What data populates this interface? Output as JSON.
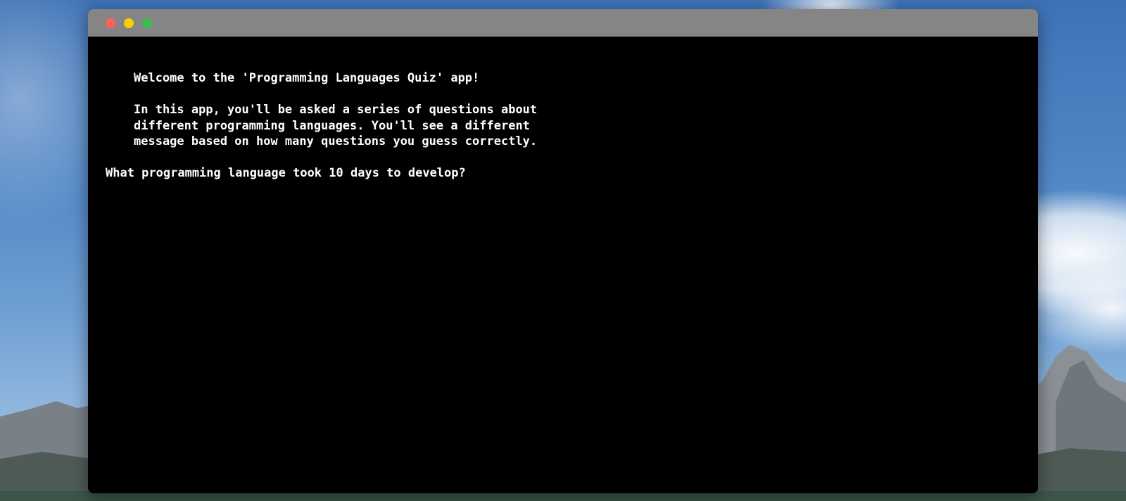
{
  "window": {
    "controls": [
      {
        "name": "close",
        "color": "#ff5f56"
      },
      {
        "name": "minimize",
        "color": "#ffcc00"
      },
      {
        "name": "maximize",
        "color": "#3bbf4a"
      }
    ]
  },
  "terminal": {
    "welcome": "Welcome to the 'Programming Languages Quiz' app!",
    "intro_lines": [
      "In this app, you'll be asked a series of questions about",
      "different programming languages. You'll see a different",
      "message based on how many questions you guess correctly."
    ],
    "question": "What programming language took 10 days to develop?"
  }
}
